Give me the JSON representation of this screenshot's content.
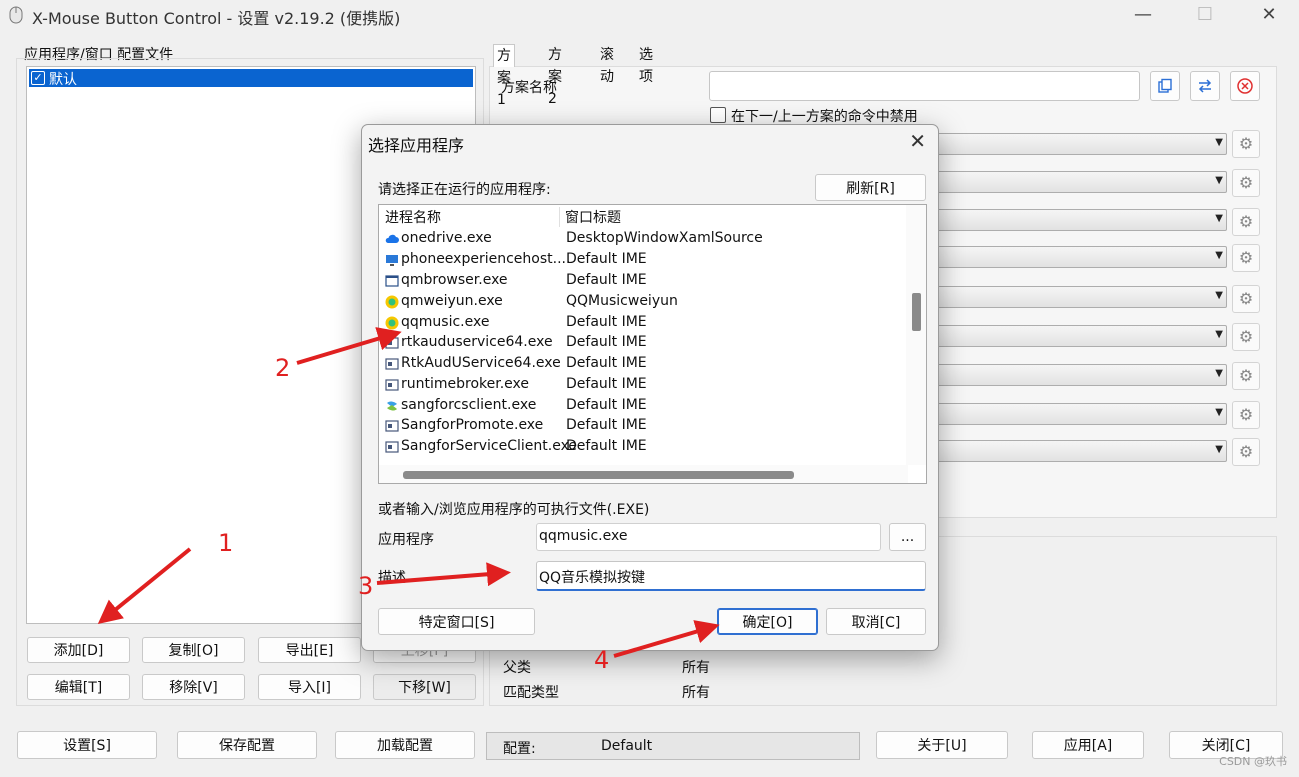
{
  "window": {
    "title": "X-Mouse Button Control - 设置 v2.19.2 (便携版)",
    "minimize": "—",
    "maximize": "☐",
    "close": "✕"
  },
  "left_panel": {
    "group_label": "应用程序/窗口 配置文件",
    "profiles": [
      {
        "label": "默认",
        "checked": true
      }
    ],
    "buttons": {
      "add": "添加[D]",
      "copy": "复制[O]",
      "export": "导出[E]",
      "move_up": "上移[P]",
      "edit": "编辑[T]",
      "remove": "移除[V]",
      "import": "导入[I]",
      "move_down": "下移[W]"
    }
  },
  "right_panel": {
    "tabs": [
      "方案 1",
      "方案 2",
      "滚动",
      "选项"
    ],
    "active_tab": 0,
    "scheme_name_label": "方案名称",
    "scheme_name_value": "",
    "disable_checkbox_label": "在下一/上一方案的命令中禁用",
    "icon_buttons": [
      "copy-icon",
      "swap-icon",
      "clear-icon"
    ],
    "details": [
      {
        "key": "父类",
        "value": "所有"
      },
      {
        "key": "匹配类型",
        "value": "所有"
      }
    ]
  },
  "bottom_bar": {
    "settings": "设置[S]",
    "save_config": "保存配置",
    "load_config": "加载配置",
    "config_label": "配置:",
    "config_value": "Default",
    "about": "关于[U]",
    "apply": "应用[A]",
    "close": "关闭[C]"
  },
  "dialog": {
    "title": "选择应用程序",
    "close": "✕",
    "prompt": "请选择正在运行的应用程序:",
    "refresh": "刷新[R]",
    "columns": [
      "进程名称",
      "窗口标题"
    ],
    "processes": [
      {
        "name": "onedrive.exe",
        "title": "DesktopWindowXamlSource",
        "icon": "cloud-icon"
      },
      {
        "name": "phoneexperiencehost....",
        "title": "Default IME",
        "icon": "phone-link-icon"
      },
      {
        "name": "qmbrowser.exe",
        "title": "Default IME",
        "icon": "window-icon"
      },
      {
        "name": "qmweiyun.exe",
        "title": "QQMusicweiyun",
        "icon": "qqmusic-icon"
      },
      {
        "name": "qqmusic.exe",
        "title": "Default IME",
        "icon": "qqmusic-icon"
      },
      {
        "name": "rtkauduservice64.exe",
        "title": "Default IME",
        "icon": "app-icon"
      },
      {
        "name": "RtkAudUService64.exe",
        "title": "Default IME",
        "icon": "app-icon"
      },
      {
        "name": "runtimebroker.exe",
        "title": "Default IME",
        "icon": "app-icon"
      },
      {
        "name": "sangforcsclient.exe",
        "title": "Default IME",
        "icon": "sangfor-icon"
      },
      {
        "name": "SangforPromote.exe",
        "title": "Default IME",
        "icon": "app-icon"
      },
      {
        "name": "SangforServiceClient.exe",
        "title": "Default IME",
        "icon": "app-icon"
      }
    ],
    "browse_label": "或者输入/浏览应用程序的可执行文件(.EXE)",
    "app_label": "应用程序",
    "app_value": "qqmusic.exe",
    "browse_button": "...",
    "desc_label": "描述",
    "desc_value": "QQ音乐模拟按键",
    "special_window": "特定窗口[S]",
    "ok": "确定[O]",
    "cancel": "取消[C]"
  },
  "annotations": {
    "color": "#e02020",
    "labels": [
      "1",
      "2",
      "3",
      "4"
    ]
  },
  "watermark": "CSDN @玖书"
}
